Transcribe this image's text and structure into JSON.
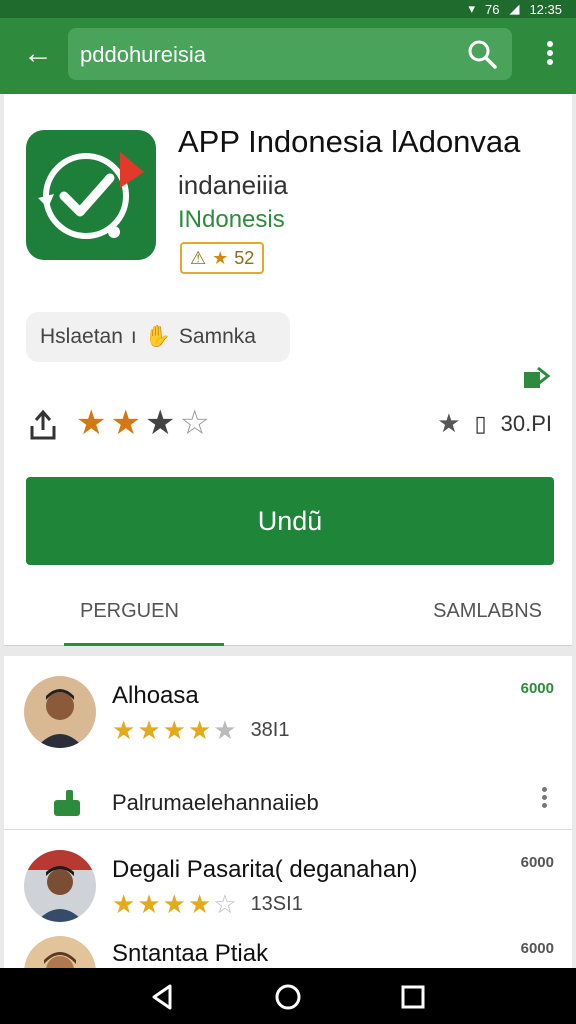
{
  "status": {
    "time": "12:35",
    "battery": "76"
  },
  "search": {
    "text": "pddohureisia"
  },
  "app": {
    "title": "APP Indonesia lAdonvaa",
    "developer": "indaneiiia",
    "category": "INdonesis",
    "badge": "52"
  },
  "chip": {
    "label_left": "Hslaetan",
    "label_right": "Samnka"
  },
  "rating": {
    "stars": 3,
    "meta": "30.PI"
  },
  "install": {
    "label": "Undũ"
  },
  "tabs": [
    {
      "label": "PERGUEN"
    },
    {
      "label": "SAMLABNS"
    }
  ],
  "reviews": [
    {
      "name": "Alhoasa",
      "stars": 4,
      "count": "38I1",
      "meta": "6000"
    },
    {
      "name": "Degali Pasarita( deganahan)",
      "stars": 4,
      "count": "13SI1",
      "meta": "6000"
    },
    {
      "name": "Sntantaa Ptiak",
      "meta": "6000"
    }
  ],
  "reply": {
    "text": "Palrumaelehannaiieb"
  },
  "colors": {
    "brand": "#2e8b3d",
    "status_bar": "#1f6b2e",
    "install": "#1e8539",
    "star": "#d4780f"
  }
}
